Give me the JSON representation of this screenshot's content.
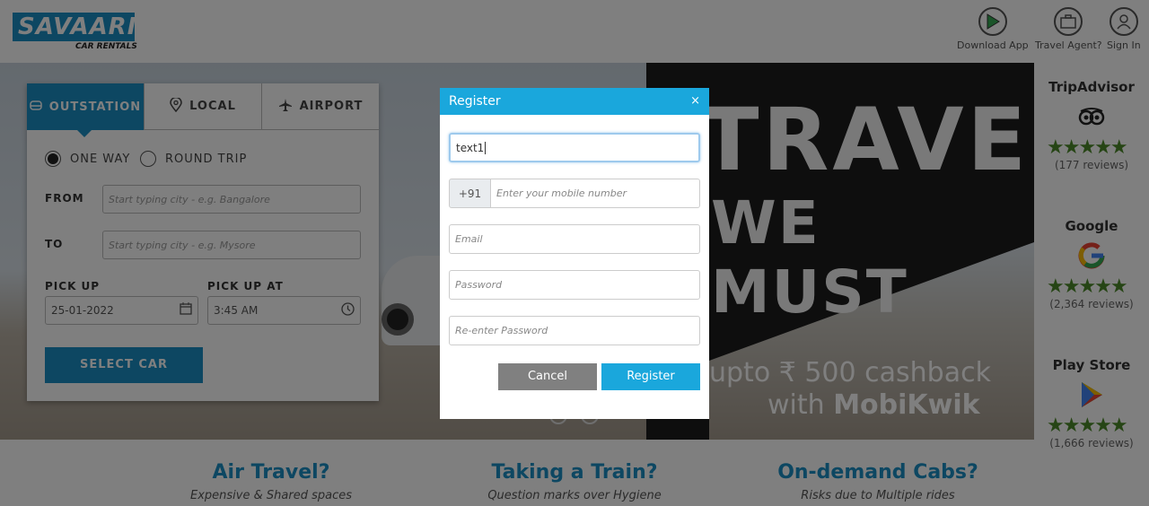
{
  "header": {
    "logo_text": "SAVAARI",
    "logo_sub": "CAR RENTALS",
    "download_app": "Download App",
    "travel_agent": "Travel Agent?",
    "sign_in": "Sign In"
  },
  "hero": {
    "headline1": "TRAVEL",
    "headline2": "WE MUST",
    "cashback": "upto ₹ 500 cashback",
    "with": "with",
    "brand": "MobiKwik"
  },
  "booking": {
    "tabs": [
      "OUTSTATION",
      "LOCAL",
      "AIRPORT"
    ],
    "trip_types": [
      "ONE WAY",
      "ROUND TRIP"
    ],
    "selected_trip": "ONE WAY",
    "from_label": "FROM",
    "from_placeholder": "Start typing city - e.g. Bangalore",
    "to_label": "TO",
    "to_placeholder": "Start typing city - e.g. Mysore",
    "pickup_label": "PICK UP",
    "pickup_date": "25-01-2022",
    "pickup_at_label": "PICK UP AT",
    "pickup_time": "3:45 AM",
    "select_car": "SELECT CAR"
  },
  "ratings": [
    {
      "title": "TripAdvisor",
      "stars": "★★★★★",
      "reviews": "(177 reviews)"
    },
    {
      "title": "Google",
      "stars": "★★★★★",
      "reviews": "(2,364 reviews)"
    },
    {
      "title": "Play Store",
      "stars": "★★★★★",
      "reviews": "(1,666 reviews)"
    }
  ],
  "info": [
    {
      "title": "Air Travel?",
      "subtitle": "Expensive & Shared spaces"
    },
    {
      "title": "Taking a Train?",
      "subtitle": "Question marks over Hygiene"
    },
    {
      "title": "On-demand Cabs?",
      "subtitle": "Risks due to Multiple rides"
    }
  ],
  "modal": {
    "title": "Register",
    "close": "×",
    "name_value": "text1",
    "country_code": "+91",
    "mobile_placeholder": "Enter your mobile number",
    "email_placeholder": "Email",
    "password_placeholder": "Password",
    "reenter_placeholder": "Re-enter Password",
    "cancel": "Cancel",
    "register": "Register"
  },
  "colors": {
    "brand_blue": "#1a8fc4",
    "modal_blue": "#1aa7dc",
    "star_green": "#4d8a2a"
  }
}
